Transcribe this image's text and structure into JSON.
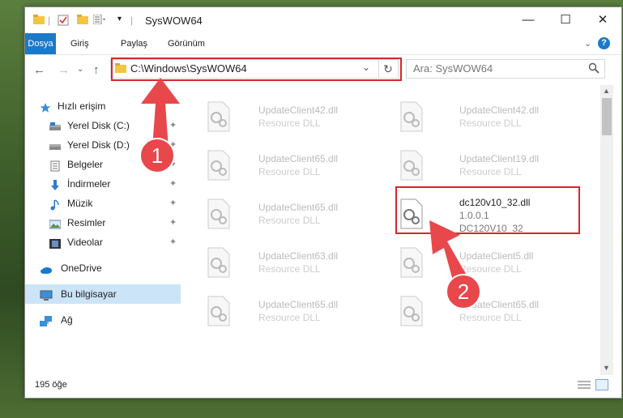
{
  "window": {
    "title": "SysWOW64",
    "min_label": "—",
    "max_label": "☐",
    "close_label": "✕"
  },
  "ribbon": {
    "tabs": [
      "Dosya",
      "Giriş",
      "Paylaş",
      "Görünüm"
    ],
    "expand_label": "⌄",
    "help_label": "?"
  },
  "nav": {
    "back": "←",
    "forward": "→",
    "history": "⌄",
    "up": "↑",
    "address": "C:\\Windows\\SysWOW64",
    "address_dropdown": "⌄",
    "refresh": "↻",
    "search_placeholder": "Ara: SysWOW64",
    "search_icon": "search-icon"
  },
  "sidebar": {
    "items": [
      {
        "label": "Hızlı erişim",
        "pinned": false
      },
      {
        "label": "Yerel Disk (C:)",
        "pinned": true
      },
      {
        "label": "Yerel Disk (D:)",
        "pinned": true
      },
      {
        "label": "Belgeler",
        "pinned": true
      },
      {
        "label": "İndirmeler",
        "pinned": true
      },
      {
        "label": "Müzik",
        "pinned": true
      },
      {
        "label": "Resimler",
        "pinned": true
      },
      {
        "label": "Videolar",
        "pinned": true
      },
      {
        "label": "OneDrive",
        "pinned": false
      },
      {
        "label": "Bu bilgisayar",
        "pinned": false
      },
      {
        "label": "Ağ",
        "pinned": false
      }
    ],
    "pin_glyph": "📌"
  },
  "files": {
    "left": [
      {
        "name": "UpdateClient42.dll",
        "type": "Resource DLL"
      },
      {
        "name": "UpdateClient65.dll",
        "type": "Resource DLL"
      },
      {
        "name": "UpdateClient65.dll",
        "type": "Resource DLL"
      },
      {
        "name": "UpdateClient63.dll",
        "type": "Resource DLL"
      },
      {
        "name": "UpdateClient65.dll",
        "type": "Resource DLL"
      }
    ],
    "right": [
      {
        "name": "UpdateClient42.dll",
        "type": "Resource DLL"
      },
      {
        "name": "UpdateClient19.dll",
        "type": "Resource DLL"
      },
      {
        "name": "dc120v10_32.dll",
        "version": "1.0.0.1",
        "desc": "DC120V10_32"
      },
      {
        "name": "UpdateClient5.dll",
        "type": "Resource DLL"
      },
      {
        "name": "UpdateClient65.dll",
        "type": "Resource DLL"
      }
    ]
  },
  "status": {
    "count": "195 öğe"
  },
  "annotations": {
    "step1": "1",
    "step2": "2",
    "color": "#d9262b"
  }
}
